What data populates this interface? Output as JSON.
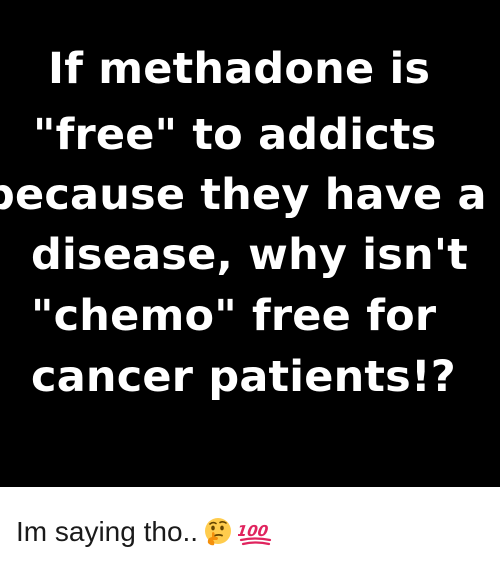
{
  "meme": {
    "lines": [
      "If methadone is",
      "\"free\" to addicts",
      "because they have a",
      "disease, why isn't",
      "\"chemo\" free for",
      "cancer patients!?"
    ]
  },
  "caption": {
    "text": "Im saying tho..",
    "emojis": [
      "thinking-face-icon",
      "hundred-points-icon"
    ]
  },
  "colors": {
    "panel_background": "#000000",
    "panel_text": "#ffffff",
    "caption_text": "#1a1a1a",
    "hundred_red": "#e0245e"
  }
}
